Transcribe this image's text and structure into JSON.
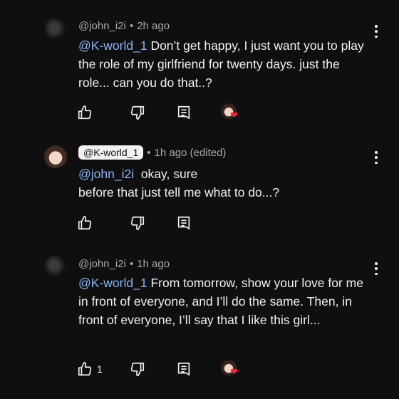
{
  "comments": [
    {
      "author": "@john_i2i",
      "time": "2h ago",
      "mention": "@K-world_1",
      "body": "Don’t get happy, I just want you to play the role of my girlfriend for twenty days. just the role... can you do that..?",
      "likes": "",
      "creator_hearted": true
    },
    {
      "author": "@K-world_1",
      "time": "1h ago (edited)",
      "mention": "@john_i2i",
      "body_line1": "okay, sure",
      "body_line2": "before that just tell me what to do...?",
      "likes": "",
      "creator_hearted": false
    },
    {
      "author": "@john_i2i",
      "time": "1h ago",
      "mention": "@K-world_1",
      "body": "From tomorrow, show your love for me in front of everyone, and I’ll do the same. Then, in front of everyone, I’ll say that I like this girl...",
      "likes": "1",
      "creator_hearted": true
    }
  ],
  "separator": "•",
  "icons": {
    "like": "thumbs-up-icon",
    "dislike": "thumbs-down-icon",
    "reply": "reply-icon",
    "more": "more-vertical-icon",
    "heart": "heart-icon"
  },
  "colors": {
    "background": "#0f0f0f",
    "text": "#f1f1f1",
    "meta": "#aaaaaa",
    "mention": "#8ab4f8",
    "heart": "#ff1f3d"
  }
}
